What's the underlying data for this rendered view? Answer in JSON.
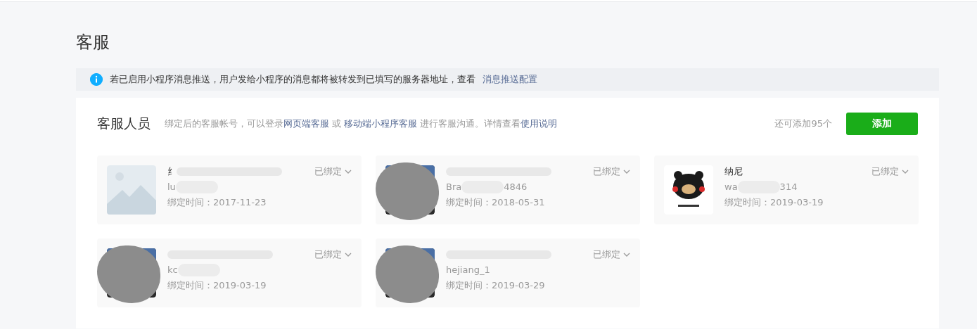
{
  "page_title": "客服",
  "notice": {
    "text": "若已启用小程序消息推送，用户发给小程序的消息都将被转发到已填写的服务器地址，查看",
    "link": "消息推送配置"
  },
  "panel": {
    "title": "客服人员",
    "desc_parts": [
      {
        "kind": "text",
        "text": "绑定后的客服帐号，可以登录"
      },
      {
        "kind": "link",
        "text": "网页端客服"
      },
      {
        "kind": "text",
        "text": " 或 "
      },
      {
        "kind": "link",
        "text": "移动端小程序客服"
      },
      {
        "kind": "text",
        "text": " 进行客服沟通。详情查看"
      },
      {
        "kind": "link",
        "text": "使用说明"
      }
    ],
    "remaining": "还可添加95个",
    "add_button": "添加"
  },
  "agents": [
    {
      "avatar": {
        "kind": "placeholder"
      },
      "name": "纟",
      "name_blurred": true,
      "account": [
        {
          "kind": "text",
          "text": "lu"
        },
        {
          "kind": "blur"
        }
      ],
      "bind_time": "绑定时间：2017-11-23",
      "status": "已绑定"
    },
    {
      "avatar": {
        "kind": "redacted"
      },
      "name_blurred": true,
      "account": [
        {
          "kind": "text",
          "text": "Bra"
        },
        {
          "kind": "blur"
        },
        {
          "kind": "text",
          "text": "4846"
        }
      ],
      "bind_time": "绑定时间：2018-05-31",
      "status": "已绑定"
    },
    {
      "name": "纳尼",
      "name_blurred": false,
      "account": [
        {
          "kind": "text",
          "text": "wa"
        },
        {
          "kind": "blur"
        },
        {
          "kind": "text",
          "text": "314"
        }
      ],
      "bind_time": "绑定时间：2019-03-19",
      "status": "已绑定"
    },
    {
      "avatar": {
        "kind": "redacted"
      },
      "name_blurred": true,
      "account": [
        {
          "kind": "text",
          "text": "kc"
        },
        {
          "kind": "blur"
        }
      ],
      "bind_time": "绑定时间：2019-03-19",
      "status": "已绑定"
    },
    {
      "avatar": {
        "kind": "redacted"
      },
      "name_blurred": true,
      "account": [
        {
          "kind": "text",
          "text": "hejiang_1"
        }
      ],
      "bind_time": "绑定时间：2019-03-29",
      "status": "已绑定"
    }
  ]
}
